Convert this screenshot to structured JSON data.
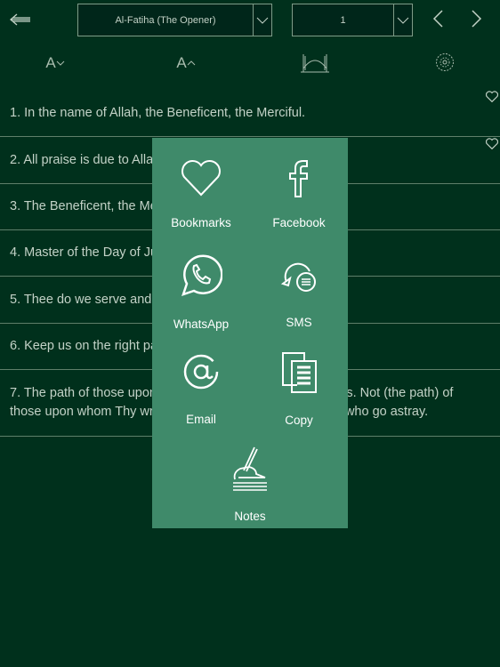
{
  "header": {
    "surah": "Al-Fatiha (The Opener)",
    "verse": "1"
  },
  "toolbar": {
    "icons": [
      "font-decrease-icon",
      "font-increase-icon",
      "mosque-icon",
      "settings-flower-icon"
    ],
    "font_down": "A",
    "font_up": "A"
  },
  "verses": [
    {
      "text": "1. In the name of Allah, the Beneficent, the Merciful."
    },
    {
      "text": "2. All praise is due to Allah, the Lord of the Worlds."
    },
    {
      "text": "3. The Beneficent, the Merciful."
    },
    {
      "text": "4. Master of the Day of Judgment."
    },
    {
      "text": "5. Thee do we serve and Thee do we beseech for help."
    },
    {
      "text": "6. Keep us on the right path."
    },
    {
      "text": "7. The path of those upon whom Thou hast bestowed favors. Not (the path) of those upon whom Thy wrath is brought down, nor of those who go astray."
    }
  ],
  "menu": {
    "bookmarks": "Bookmarks",
    "facebook": "Facebook",
    "whatsapp": "WhatsApp",
    "sms": "SMS",
    "email": "Email",
    "copy": "Copy",
    "notes": "Notes"
  },
  "colors": {
    "background": "#00301c",
    "popup": "#3f8a6a"
  }
}
